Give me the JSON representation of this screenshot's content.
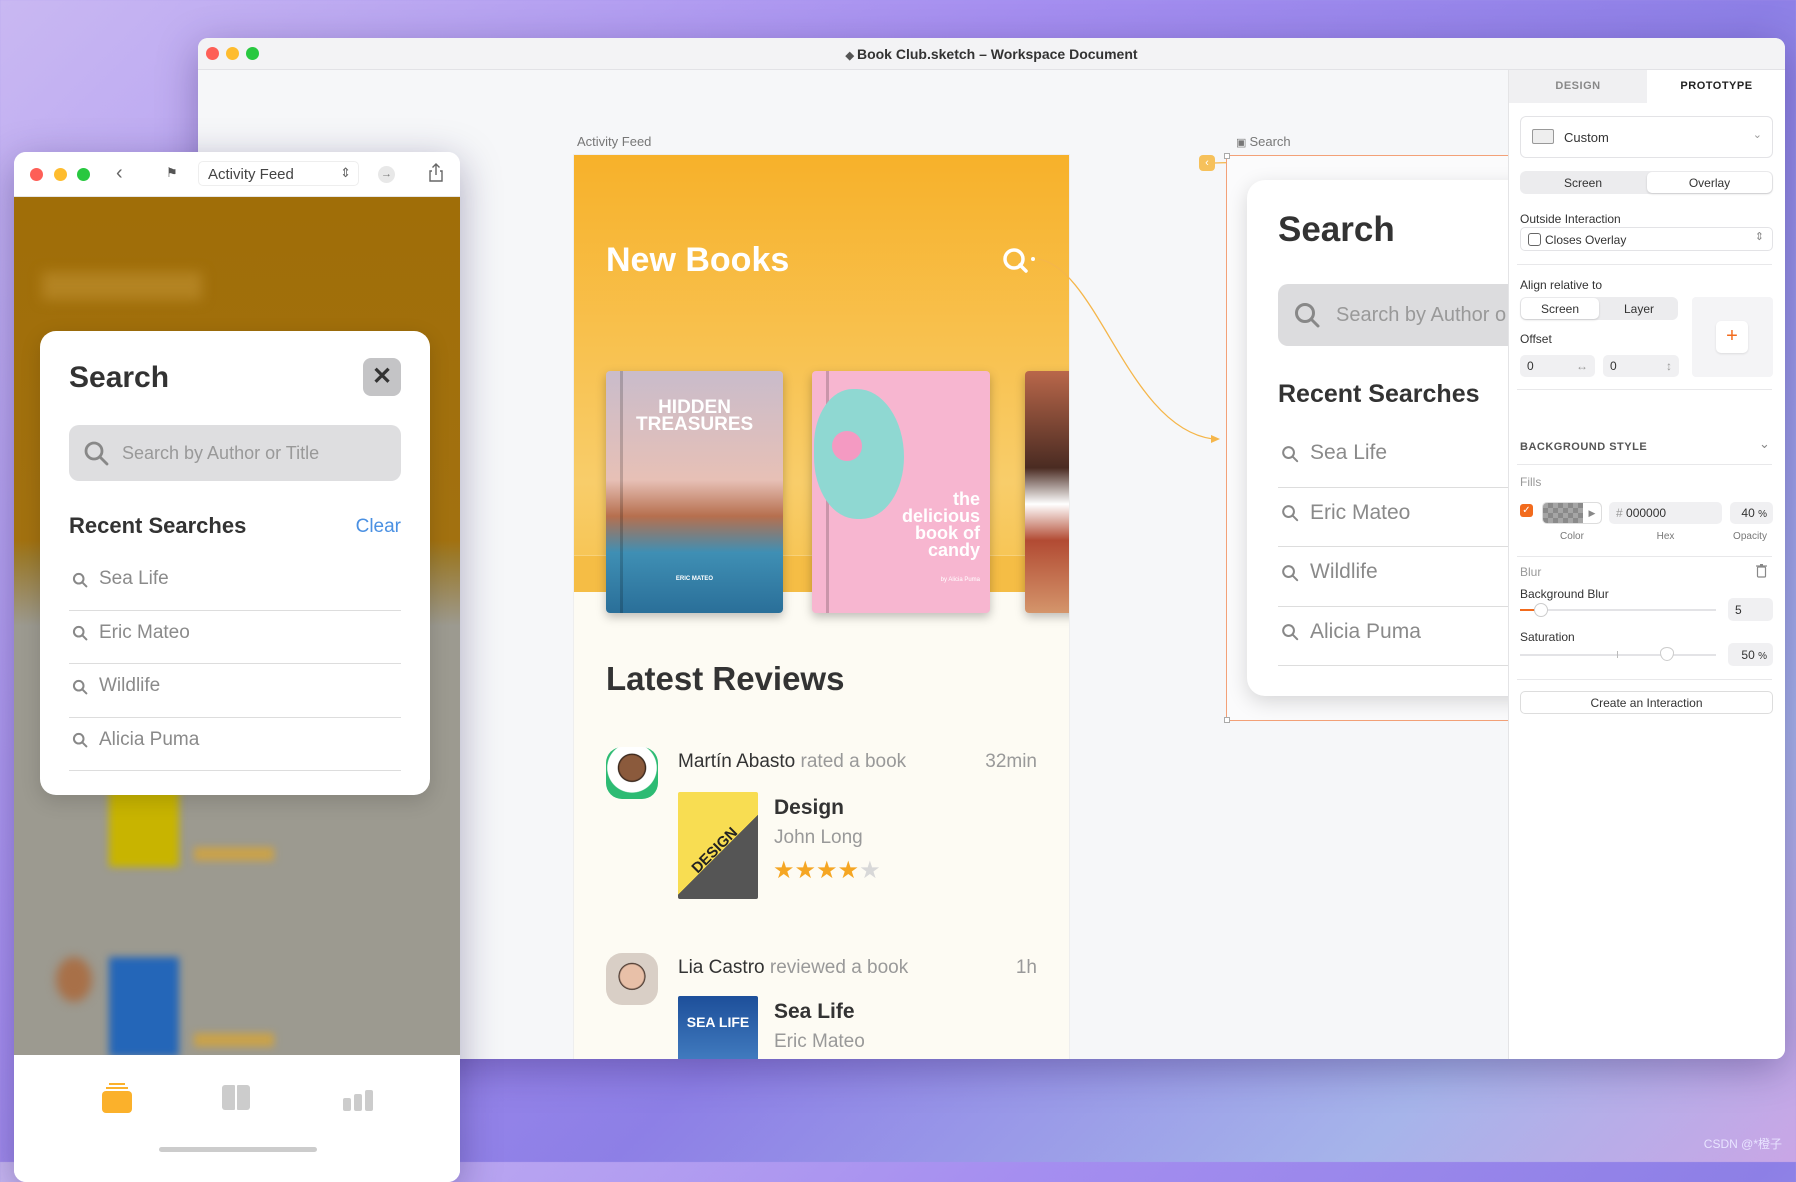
{
  "window": {
    "title": "Book Club.sketch – Workspace Document"
  },
  "canvas": {
    "activity_feed": {
      "label": "Activity Feed",
      "header": "New Books",
      "books": [
        {
          "title": "HIDDEN TREASURES",
          "author": "ERIC MATEO"
        },
        {
          "title": "the delicious book of candy",
          "author": "by Alicia Puma"
        }
      ],
      "latest_title": "Latest Reviews",
      "reviews": [
        {
          "user": "Martín Abasto",
          "action": "rated a book",
          "time": "32min",
          "book": "Design",
          "cover_text": "DESIGN",
          "author": "John Long",
          "rating": 4,
          "max_rating": 5
        },
        {
          "user": "Lia Castro",
          "action": "reviewed a book",
          "time": "1h",
          "book": "Sea Life",
          "cover_text": "SEA LIFE",
          "author": "Eric Mateo"
        }
      ]
    },
    "search_artboard": {
      "label": "Search",
      "title": "Search",
      "placeholder": "Search by Author o",
      "recent_title": "Recent Searches",
      "items": [
        "Sea Life",
        "Eric Mateo",
        "Wildlife",
        "Alicia Puma"
      ]
    }
  },
  "panel": {
    "tabs": [
      "DESIGN",
      "PROTOTYPE"
    ],
    "active_tab": "PROTOTYPE",
    "device": "Custom",
    "type_options": [
      "Screen",
      "Overlay"
    ],
    "type_selected": "Overlay",
    "outside_label": "Outside Interaction",
    "outside_value": "Closes Overlay",
    "align_label": "Align relative to",
    "align_options": [
      "Screen",
      "Layer"
    ],
    "align_selected": "Screen",
    "offset_label": "Offset",
    "offset_x": "0",
    "offset_y": "0",
    "bg_style": "BACKGROUND STYLE",
    "fills_label": "Fills",
    "fill_enabled": true,
    "hex_prefix": "#",
    "hex": "000000",
    "opacity": "40",
    "percent": "%",
    "fill_labels": [
      "Color",
      "Hex",
      "Opacity"
    ],
    "blur_label": "Blur",
    "bg_blur_label": "Background Blur",
    "bg_blur": "5",
    "saturation_label": "Saturation",
    "saturation": "50",
    "create_button": "Create an Interaction",
    "accent": "#f26b1d"
  },
  "phone": {
    "page": "Activity Feed",
    "modal": {
      "title": "Search",
      "placeholder": "Search by Author or Title",
      "recent_title": "Recent Searches",
      "clear": "Clear",
      "items": [
        "Sea Life",
        "Eric Mateo",
        "Wildlife",
        "Alicia Puma"
      ]
    },
    "tabs": [
      "feed-icon",
      "books-icon",
      "stats-icon"
    ],
    "active_tab": "feed-icon",
    "accent": "#fbb12b",
    "link_color": "#4a90e2"
  },
  "watermark": "CSDN @*橙子"
}
